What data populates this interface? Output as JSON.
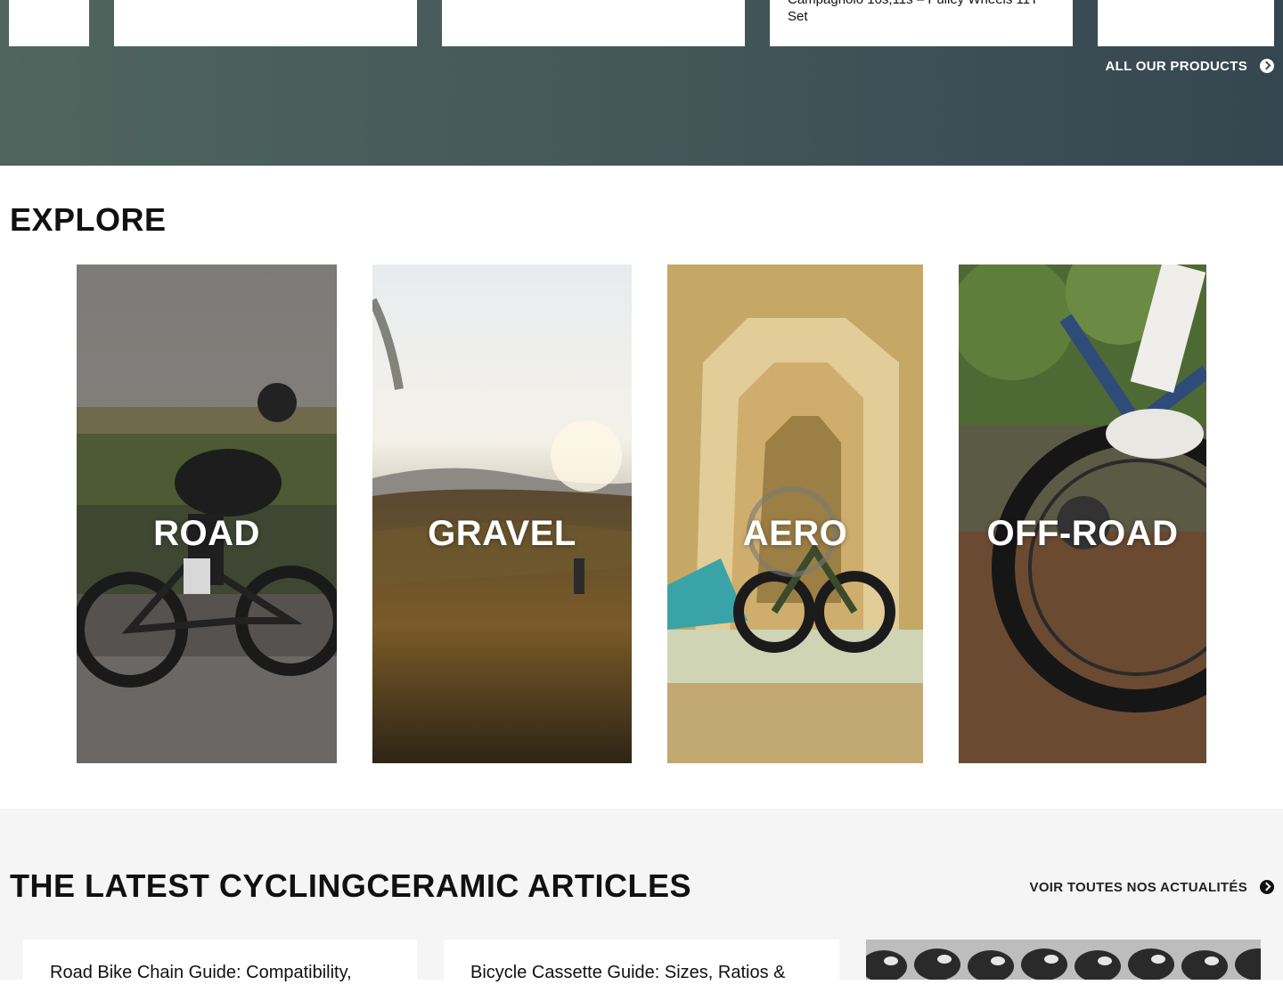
{
  "products": {
    "items": [
      {
        "title": ""
      },
      {
        "title": ""
      },
      {
        "title": ""
      },
      {
        "title": "Campagnolo 10s,11s – Pulley Wheels 11T Set"
      },
      {
        "title": ""
      }
    ],
    "all_link": "ALL OUR PRODUCTS",
    "arrow_icon": "arrow-circle-right-icon"
  },
  "explore": {
    "title": "EXPLORE",
    "tiles": [
      {
        "label": "ROAD"
      },
      {
        "label": "GRAVEL"
      },
      {
        "label": "AERO"
      },
      {
        "label": "OFF-ROAD"
      }
    ]
  },
  "articles": {
    "title": "THE LATEST CYCLINGCERAMIC ARTICLES",
    "see_all": "VOIR TOUTES NOS ACTUALITÉS",
    "items": [
      {
        "title": "Road Bike Chain Guide: Compatibility,"
      },
      {
        "title": "Bicycle Cassette Guide: Sizes, Ratios &"
      }
    ]
  },
  "colors": {
    "band_start": "#4f655d",
    "band_end": "#364650",
    "articles_bg": "#f5f5f5"
  }
}
